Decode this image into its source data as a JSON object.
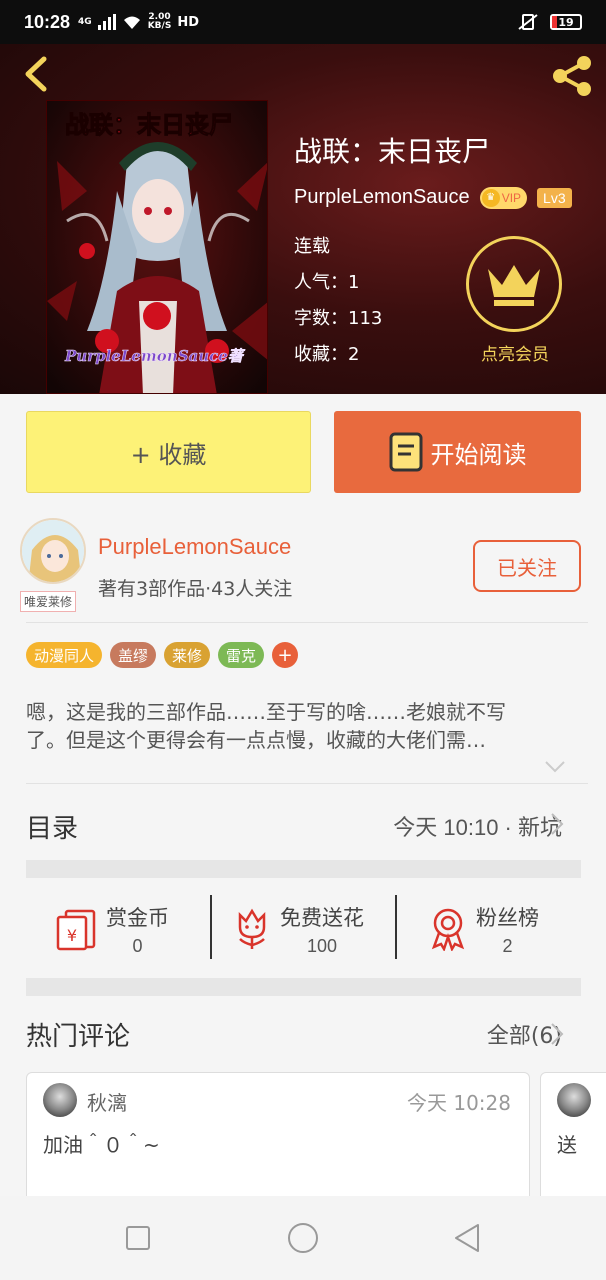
{
  "status_bar": {
    "time": "10:28",
    "network": "4G",
    "speed_value": "2.00",
    "speed_unit": "KB/S",
    "hd": "HD",
    "battery": "19"
  },
  "header": {
    "book_title": "战联：末日丧尸",
    "cover_title": "战联：末日丧尸",
    "cover_signature": "PurpleLemonSauce著"
  },
  "author_line": {
    "name": "PurpleLemonSauce",
    "vip": "VIP",
    "level": "Lv3"
  },
  "meta": {
    "status": "连载",
    "popularity": "人气：1",
    "word_count": "字数：113",
    "favorites": "收藏：2"
  },
  "member": {
    "label": "点亮会员"
  },
  "actions": {
    "favorite": "+ 收藏",
    "read": "开始阅读"
  },
  "author": {
    "name": "PurpleLemonSauce",
    "stats": "著有3部作品·43人关注",
    "avatar_tag": "唯爱莱修",
    "follow": "已关注"
  },
  "tags": [
    {
      "label": "动漫同人",
      "color": "#f5b42e"
    },
    {
      "label": "盖缪",
      "color": "#c77a5e"
    },
    {
      "label": "莱修",
      "color": "#d9a232"
    },
    {
      "label": "雷克",
      "color": "#7db955"
    }
  ],
  "tag_add": "+",
  "description": {
    "line1": "嗯，这是我的三部作品……至于写的啥……老娘就不写",
    "line2": "了。但是这个更得会有一点点慢，收藏的大佬们需…"
  },
  "toc": {
    "label": "目录",
    "latest": "今天 10:10 · 新坑"
  },
  "stats": {
    "reward": {
      "label": "赏金币",
      "value": "0"
    },
    "flowers": {
      "label": "免费送花",
      "value": "100"
    },
    "fans": {
      "label": "粉丝榜",
      "value": "2"
    }
  },
  "hot_comments": {
    "label": "热门评论",
    "all": "全部(6)"
  },
  "comments": [
    {
      "user": "秋漓",
      "time": "今天 10:28",
      "text": "加油＾０＾~"
    },
    {
      "text": "送"
    }
  ],
  "colors": {
    "accent": "#e8603a",
    "favorite_bg": "#fdf277",
    "gold": "#f3d35b"
  }
}
